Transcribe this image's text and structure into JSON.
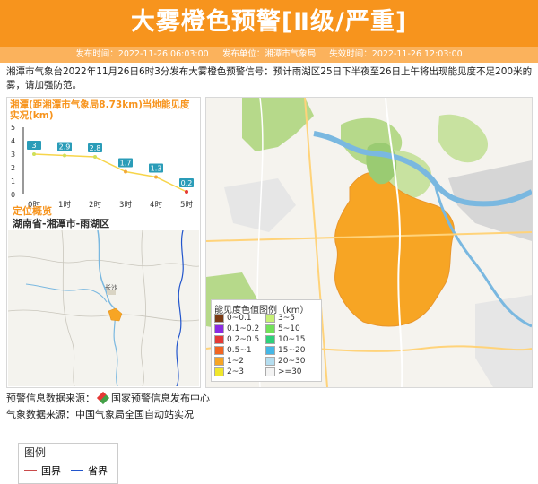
{
  "header": {
    "title": "大雾橙色预警[Ⅱ级/严重]"
  },
  "meta": {
    "issue_time": "发布时间：2022-11-26 06:03:00",
    "issuer": "发布单位：湘潭市气象局",
    "expire_time": "失效时间：2022-11-26 12:03:00"
  },
  "description": "湘潭市气象台2022年11月26日6时3分发布大雾橙色预警信号：预计雨湖区25日下半夜至26日上午将出现能见度不足200米的雾，请加强防范。",
  "chart_title": "湘潭(距湘潭市气象局8.73km)当地能见度实况(km)",
  "chart_data": {
    "type": "line",
    "title": "湘潭(距湘潭市气象局8.73km)当地能见度实况(km)",
    "categories": [
      "0时",
      "1时",
      "2时",
      "3时",
      "4时",
      "5时"
    ],
    "values": [
      3,
      2.9,
      2.8,
      1.7,
      1.3,
      0.2
    ],
    "labels": [
      "3",
      "2.9",
      "2.8",
      "1.7",
      "1.3",
      "0.2"
    ],
    "yticks": [
      "0",
      "1",
      "2",
      "3",
      "4",
      "5"
    ],
    "ylim": [
      0,
      5
    ],
    "line_color": "#f7d54a",
    "label_bg": "#2a9cb8",
    "point_colors": [
      "#cfe05a",
      "#cfe05a",
      "#cfe05a",
      "#f2a83b",
      "#f2a83b",
      "#e53935"
    ]
  },
  "location": {
    "section_title": "定位概览",
    "region": "湖南省-湘潭市-雨湖区"
  },
  "small_map": {
    "city_label": "长沙"
  },
  "legend1": {
    "title": "图例",
    "items": [
      {
        "label": "国界",
        "color": "#c94a4a"
      },
      {
        "label": "省界",
        "color": "#2255cc"
      }
    ]
  },
  "visibility_legend": {
    "title": "能见度色值图例（km）",
    "items": [
      {
        "label": "0~0.1",
        "color": "#7b3a14"
      },
      {
        "label": "3~5",
        "color": "#c6f076"
      },
      {
        "label": "0.1~0.2",
        "color": "#8a2be2"
      },
      {
        "label": "5~10",
        "color": "#72e15a"
      },
      {
        "label": "0.2~0.5",
        "color": "#e53935"
      },
      {
        "label": "10~15",
        "color": "#2fd07a"
      },
      {
        "label": "0.5~1",
        "color": "#f26522"
      },
      {
        "label": "15~20",
        "color": "#45b7e6"
      },
      {
        "label": "1~2",
        "color": "#f7a524"
      },
      {
        "label": "20~30",
        "color": "#b5def0"
      },
      {
        "label": "2~3",
        "color": "#f0e62b"
      },
      {
        "label": ">=30",
        "color": "#f3f3f3"
      }
    ]
  },
  "footer": {
    "warn_source_label": "预警信息数据来源：",
    "warn_source_name": "国家预警信息发布中心",
    "weather_source": "气象数据来源：中国气象局全国自动站实况"
  }
}
